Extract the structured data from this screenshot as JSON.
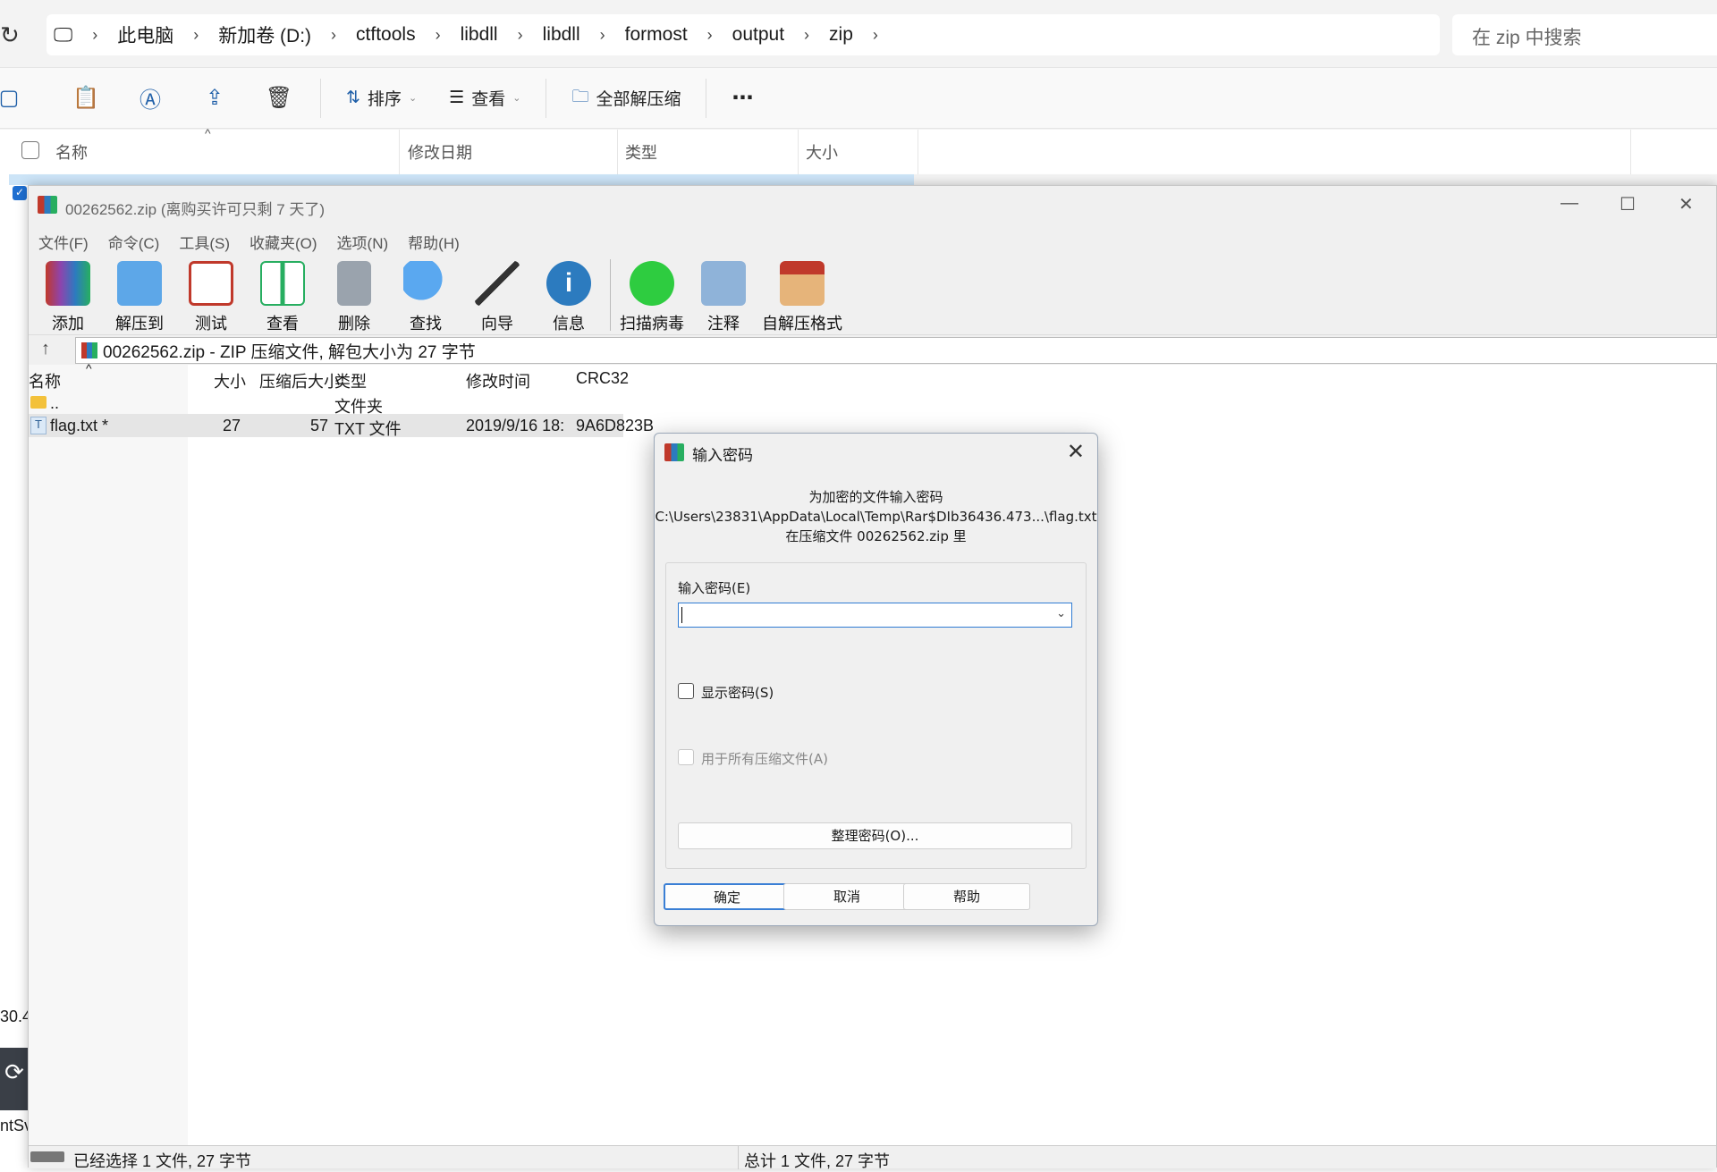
{
  "explorer": {
    "breadcrumb": [
      "此电脑",
      "新加卷 (D:)",
      "ctftools",
      "libdll",
      "libdll",
      "formost",
      "output",
      "zip"
    ],
    "search_placeholder": "在 zip 中搜索",
    "toolbar": {
      "sort": "排序",
      "view": "查看",
      "extract_all": "全部解压缩"
    },
    "columns": {
      "name": "名称",
      "date": "修改日期",
      "type": "类型",
      "size": "大小"
    },
    "side_fragments": {
      "num": "30.4",
      "label": "ntSv"
    }
  },
  "rar": {
    "title": "00262562.zip (离购买许可只剩 7 天了)",
    "menu": [
      "文件(F)",
      "命令(C)",
      "工具(S)",
      "收藏夹(O)",
      "选项(N)",
      "帮助(H)"
    ],
    "toolbar": [
      "添加",
      "解压到",
      "测试",
      "查看",
      "删除",
      "查找",
      "向导",
      "信息",
      "扫描病毒",
      "注释",
      "自解压格式"
    ],
    "path": "00262562.zip - ZIP 压缩文件, 解包大小为 27 字节",
    "columns": {
      "name": "名称",
      "size": "大小",
      "packed": "压缩后大小",
      "type": "类型",
      "modified": "修改时间",
      "crc": "CRC32"
    },
    "rows": [
      {
        "name": "..",
        "size": "",
        "packed": "",
        "type": "文件夹",
        "modified": "",
        "crc": ""
      },
      {
        "name": "flag.txt *",
        "size": "27",
        "packed": "57",
        "type": "TXT 文件",
        "modified": "2019/9/16 18:",
        "crc": "9A6D823B"
      }
    ],
    "status_left": "已经选择 1 文件, 27 字节",
    "status_right": "总计 1 文件, 27 字节"
  },
  "dialog": {
    "title": "输入密码",
    "info_line1": "为加密的文件输入密码",
    "info_line2": "C:\\Users\\23831\\AppData\\Local\\Temp\\Rar$DIb36436.473...\\flag.txt",
    "info_line3": "在压缩文件 00262562.zip 里",
    "password_label": "输入密码(E)",
    "password_value": "",
    "show_password": "显示密码(S)",
    "all_archives": "用于所有压缩文件(A)",
    "manage": "整理密码(O)...",
    "ok": "确定",
    "cancel": "取消",
    "help": "帮助"
  },
  "colors": {
    "accent": "#2f7bd3",
    "selection": "#cce4f7"
  }
}
